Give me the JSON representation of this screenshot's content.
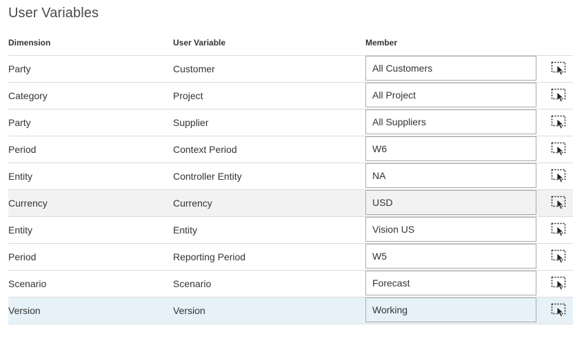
{
  "title": "User Variables",
  "columns": {
    "dimension": "Dimension",
    "user_variable": "User Variable",
    "member": "Member"
  },
  "rows": [
    {
      "dimension": "Party",
      "user_variable": "Customer",
      "member": "All Customers"
    },
    {
      "dimension": "Category",
      "user_variable": "Project",
      "member": "All Project"
    },
    {
      "dimension": "Party",
      "user_variable": "Supplier",
      "member": "All Suppliers"
    },
    {
      "dimension": "Period",
      "user_variable": "Context Period",
      "member": "W6"
    },
    {
      "dimension": "Entity",
      "user_variable": "Controller Entity",
      "member": "NA"
    },
    {
      "dimension": "Currency",
      "user_variable": "Currency",
      "member": "USD"
    },
    {
      "dimension": "Entity",
      "user_variable": "Entity",
      "member": "Vision US"
    },
    {
      "dimension": "Period",
      "user_variable": "Reporting Period",
      "member": "W5"
    },
    {
      "dimension": "Scenario",
      "user_variable": "Scenario",
      "member": "Forecast"
    },
    {
      "dimension": "Version",
      "user_variable": "Version",
      "member": "Working"
    }
  ],
  "icons": {
    "picker": "member-selector-icon"
  },
  "colors": {
    "hover_row": "#f2f2f2",
    "selected_row": "#e6f2f8",
    "border": "#dcdcdc"
  }
}
